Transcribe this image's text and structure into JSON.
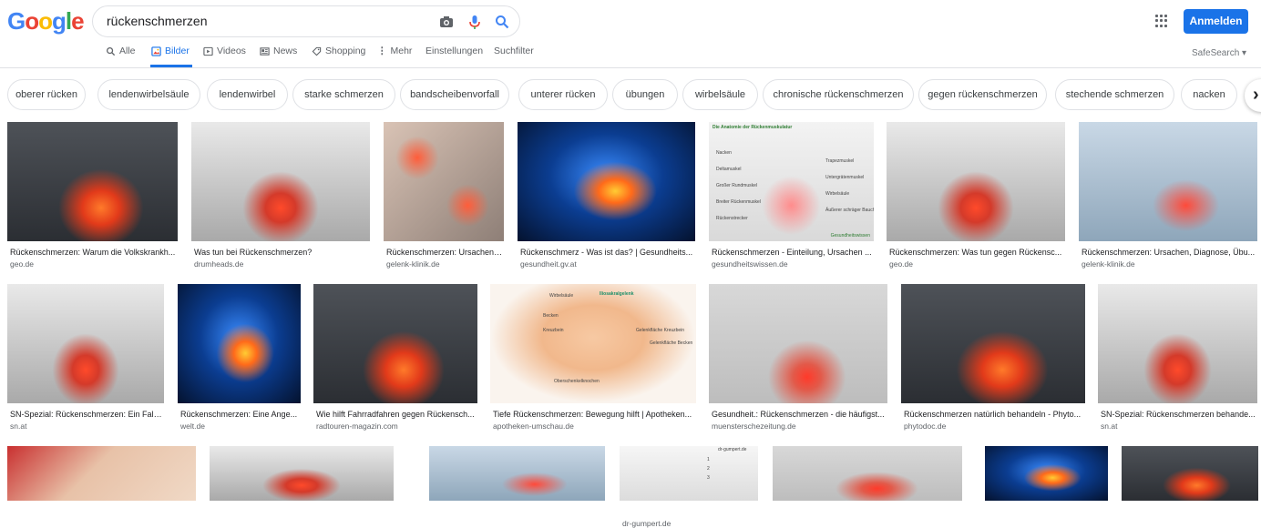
{
  "logo": "Google",
  "logo_colors": [
    "#4285F4",
    "#EA4335",
    "#FBBC05",
    "#4285F4",
    "#34A853",
    "#EA4335"
  ],
  "search": {
    "value": "rückenschmerzen"
  },
  "nav": {
    "all": "Alle",
    "images": "Bilder",
    "videos": "Videos",
    "news": "News",
    "shopping": "Shopping",
    "more": "Mehr",
    "settings": "Einstellungen",
    "tools": "Suchfilter"
  },
  "signin_label": "Anmelden",
  "safesearch_label": "SafeSearch ▾",
  "chips": [
    "oberer rücken",
    "lendenwirbelsäule",
    "lendenwirbel",
    "starke schmerzen",
    "bandscheibenvorfall",
    "unterer rücken",
    "übungen",
    "wirbelsäule",
    "chronische rückenschmerzen",
    "gegen rückenschmerzen",
    "stechende schmerzen",
    "nacken"
  ],
  "chip_next": "›",
  "results": [
    {
      "title": "Rückenschmerzen: Warum die Volkskrankh...",
      "source": "geo.de"
    },
    {
      "title": "Was tun bei Rückenschmerzen?",
      "source": "drumheads.de"
    },
    {
      "title": "Rückenschmerzen: Ursachen,...",
      "source": "gelenk-klinik.de"
    },
    {
      "title": "Rückenschmerz - Was ist das? | Gesundheits...",
      "source": "gesundheit.gv.at"
    },
    {
      "title": "Rückenschmerzen - Einteilung, Ursachen ...",
      "source": "gesundheitswissen.de",
      "labels": [
        "Die Anatomie der Rückenmuskulatur",
        "Nacken",
        "Trapezmuskel",
        "Deltamuskel",
        "Untergrätenmuskel",
        "Großer Rundmuskel",
        "Wirbelsäule",
        "Breiter Rückenmuskel",
        "Äußerer schräger Bauchmuskel",
        "Rückenstrecker",
        "Gesundheitswissen"
      ]
    },
    {
      "title": "Rückenschmerzen: Was tun gegen Rückensc...",
      "source": "geo.de"
    },
    {
      "title": "Rückenschmerzen: Ursachen, Diagnose, Übu...",
      "source": "gelenk-klinik.de"
    },
    {
      "title": "SN-Spezial: Rückenschmerzen: Ein Fall ...",
      "source": "sn.at"
    },
    {
      "title": "Rückenschmerzen: Eine Ange...",
      "source": "welt.de"
    },
    {
      "title": "Wie hilft Fahrradfahren gegen Rückensch...",
      "source": "radtouren-magazin.com"
    },
    {
      "title": "Tiefe Rückenschmerzen: Bewegung hilft | Apotheken...",
      "source": "apotheken-umschau.de",
      "labels": [
        "Wirbelsäule",
        "Becken",
        "Kreuzbein",
        "Iliosakralgelenk",
        "Gelenkfläche Kreuzbein",
        "Gelenkfläche Becken",
        "Oberschenkelknochen"
      ]
    },
    {
      "title": "Gesundheit.: Rückenschmerzen - die häufigst...",
      "source": "muensterschezeitung.de"
    },
    {
      "title": "Rückenschmerzen natürlich behandeln - Phyto...",
      "source": "phytodoc.de"
    },
    {
      "title": "SN-Spezial: Rückenschmerzen behande...",
      "source": "sn.at"
    },
    {
      "title": "",
      "source": ""
    },
    {
      "title": "",
      "source": ""
    },
    {
      "title": "",
      "source": ""
    },
    {
      "title": "",
      "source": "dr-gumpert.de",
      "labels": [
        "dr-gumpert.de",
        "1",
        "2",
        "3"
      ]
    },
    {
      "title": "",
      "source": ""
    },
    {
      "title": "",
      "source": ""
    },
    {
      "title": "",
      "source": ""
    }
  ]
}
